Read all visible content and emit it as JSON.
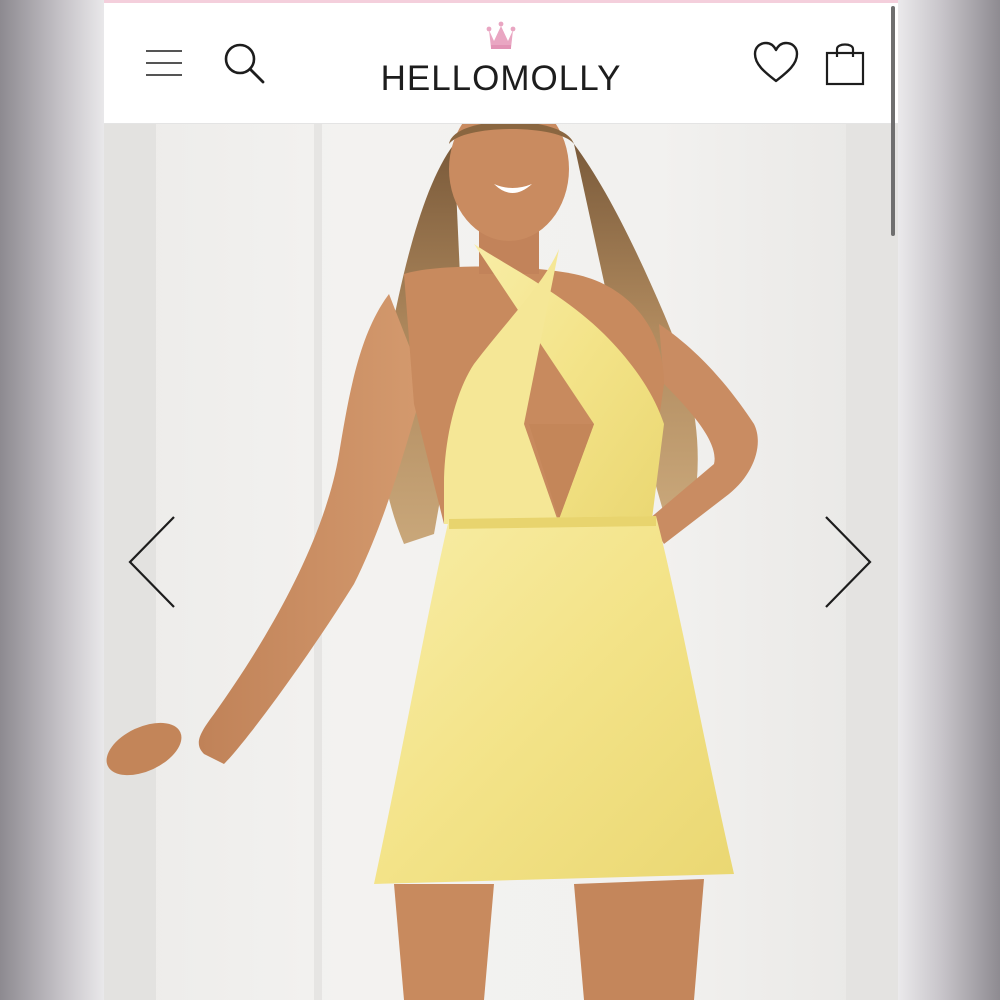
{
  "header": {
    "logo_text": "HELLOMOLLY",
    "icons": {
      "menu": "hamburger-menu-icon",
      "search": "search-icon",
      "wishlist": "heart-icon",
      "cart": "shopping-bag-icon",
      "logo_mark": "crown-icon"
    }
  },
  "carousel": {
    "prev_icon": "chevron-left-icon",
    "next_icon": "chevron-right-icon"
  },
  "colors": {
    "accent_pink": "#f4cfdc",
    "crown_pink": "#e9a6c2",
    "text_dark": "#1d1d1d",
    "dress_yellow": "#f4e58c"
  }
}
